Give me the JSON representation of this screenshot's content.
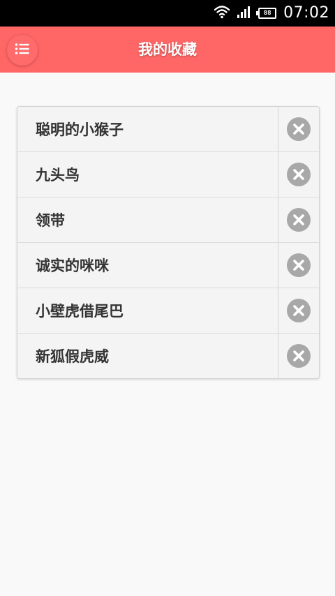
{
  "status_bar": {
    "time": "07:02",
    "battery_level": "88",
    "icons": [
      "wifi-icon",
      "signal-icon",
      "battery-icon"
    ]
  },
  "header": {
    "title": "我的收藏",
    "menu_icon": "list-icon",
    "background_color": "#ff6666"
  },
  "favorites": {
    "items": [
      {
        "label": "聪明的小猴子"
      },
      {
        "label": "九头鸟"
      },
      {
        "label": "领带"
      },
      {
        "label": "诚实的咪咪"
      },
      {
        "label": "小壁虎借尾巴"
      },
      {
        "label": "新狐假虎威"
      }
    ],
    "delete_icon": "close-circle-icon"
  }
}
